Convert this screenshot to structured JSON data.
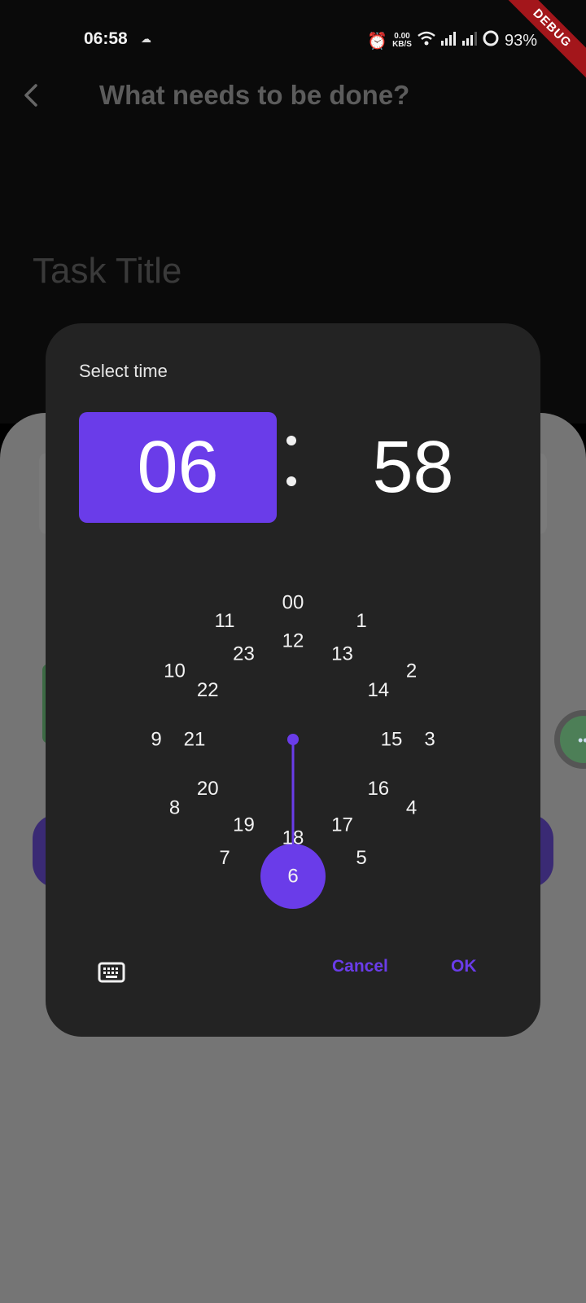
{
  "status_bar": {
    "time": "06:58",
    "sub_icon": "cloud-upload-icon",
    "alarm_icon": "alarm-icon",
    "speed_value": "0.00",
    "speed_unit": "KB/S",
    "wifi_icon": "wifi-icon",
    "signal_icon": "signal-icon",
    "battery_icon": "battery-icon",
    "battery": "93%",
    "debug_label": "DEBUG"
  },
  "app_bar": {
    "back_icon": "chevron-left-icon",
    "title": "What needs to be done?"
  },
  "form": {
    "task_title_placeholder": "Task Title"
  },
  "time_picker": {
    "heading": "Select time",
    "hour": "06",
    "separator": ":",
    "minute": "58",
    "outer_ring": [
      "00",
      "1",
      "2",
      "3",
      "4",
      "5",
      "6",
      "7",
      "8",
      "9",
      "10",
      "11"
    ],
    "inner_ring": [
      "12",
      "13",
      "14",
      "15",
      "16",
      "17",
      "18",
      "19",
      "20",
      "21",
      "22",
      "23"
    ],
    "selected_hour": "6",
    "selected_ring": "outer",
    "keyboard_icon": "keyboard-icon",
    "cancel_label": "Cancel",
    "ok_label": "OK"
  },
  "colors": {
    "accent": "#6a3ce9",
    "dialog_bg": "#232323",
    "scrim": "#757575"
  }
}
